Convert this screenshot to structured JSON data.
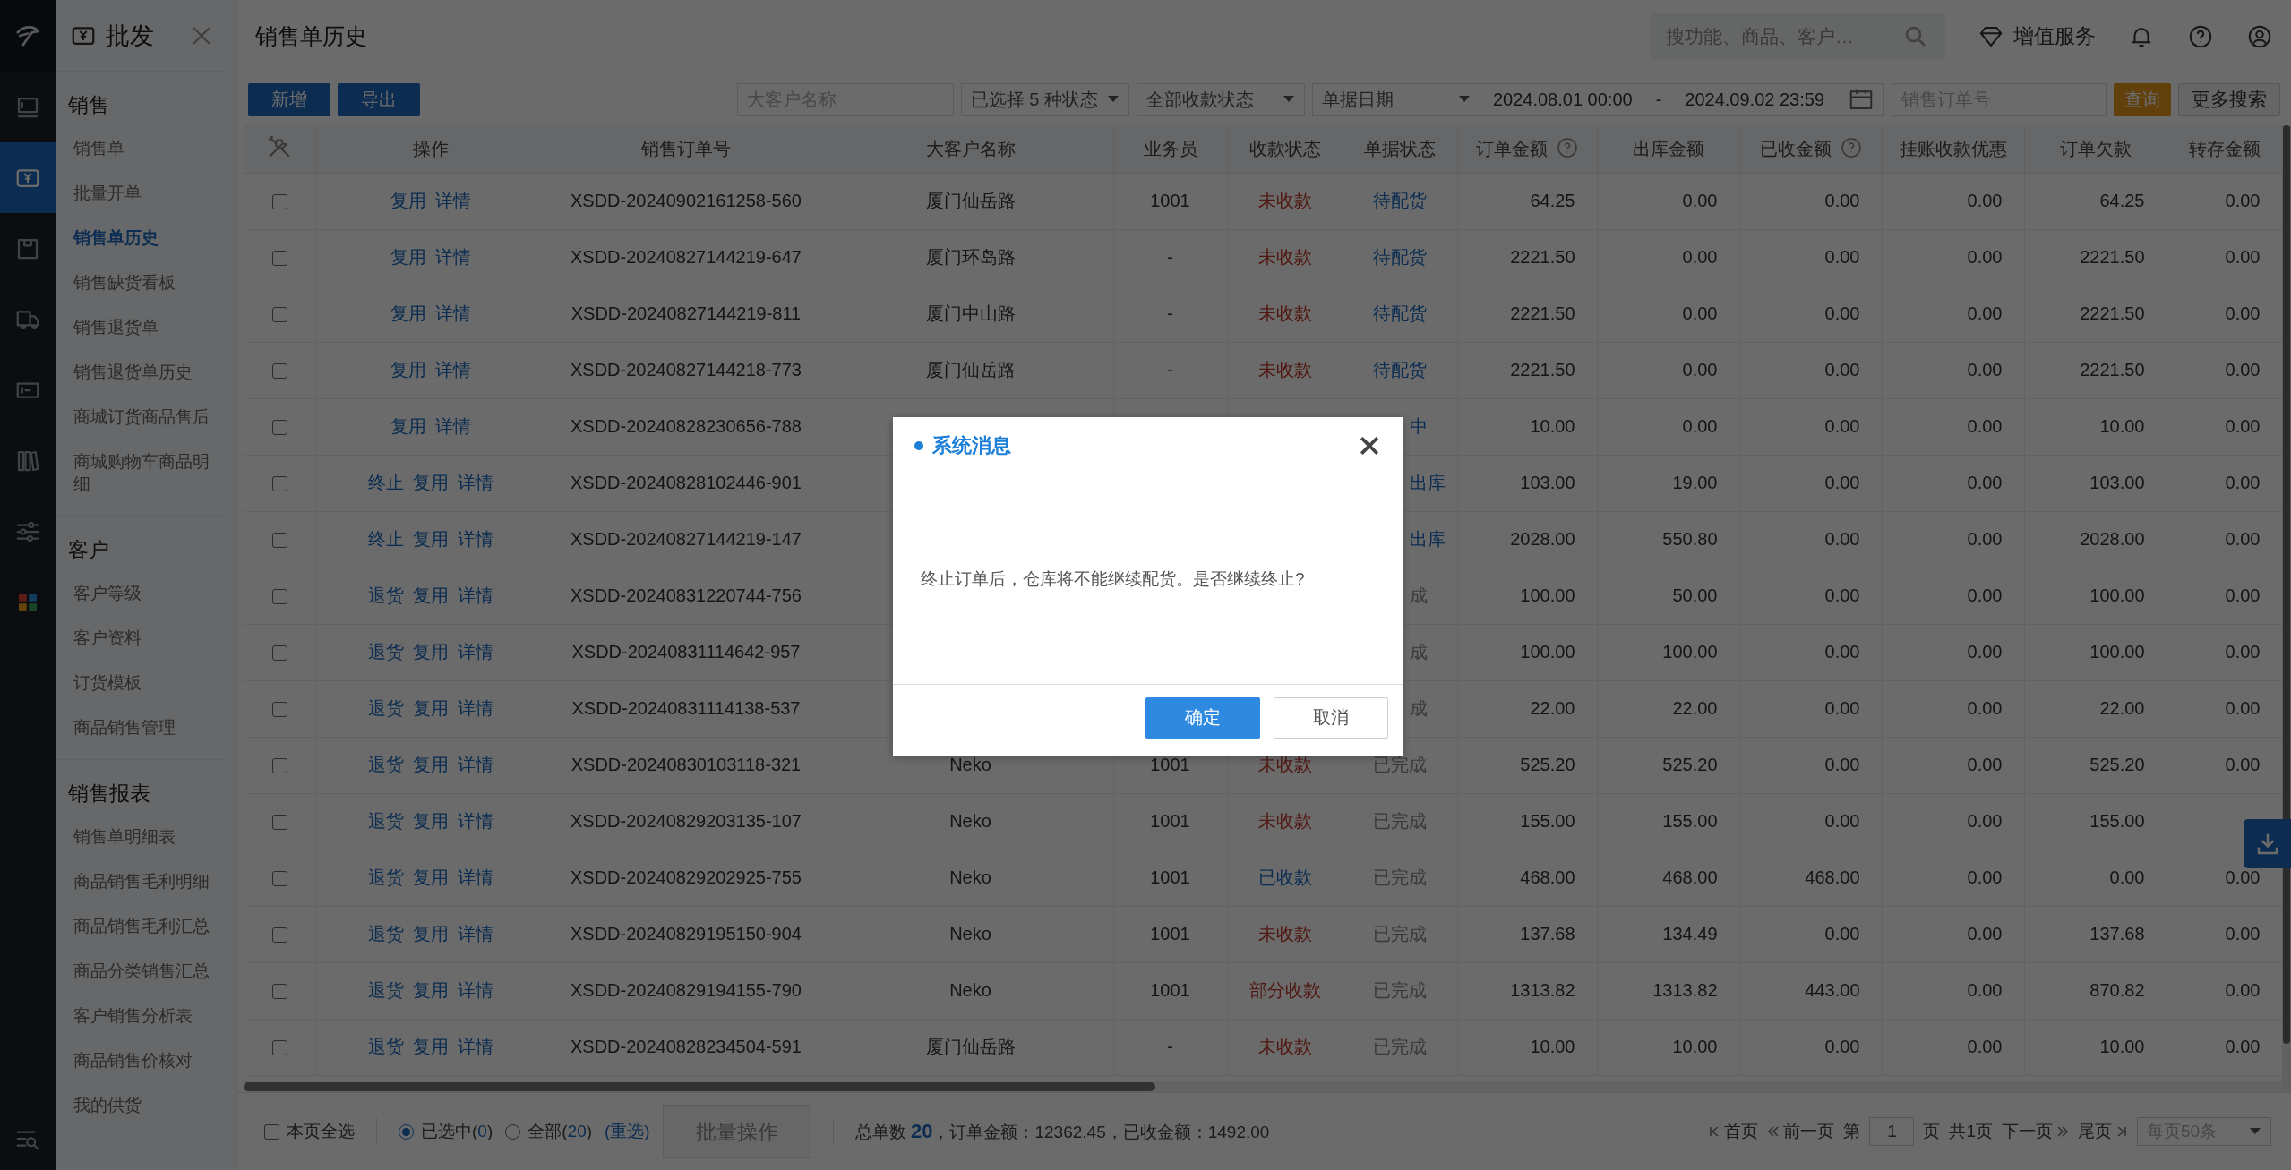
{
  "rail": {
    "items": [
      {
        "kind": "logo"
      },
      {
        "kind": "store",
        "selected": false
      },
      {
        "kind": "wholesale",
        "selected": true
      },
      {
        "kind": "box",
        "selected": false
      },
      {
        "kind": "truck",
        "selected": false
      },
      {
        "kind": "card",
        "selected": false
      },
      {
        "kind": "books",
        "selected": false
      },
      {
        "kind": "sliders",
        "selected": false
      },
      {
        "kind": "apps",
        "selected": false
      },
      {
        "kind": "search-list",
        "selected": false
      }
    ]
  },
  "sidebar": {
    "title": "批发",
    "sections": [
      {
        "title": "销售",
        "items": [
          {
            "label": "销售单",
            "selected": false
          },
          {
            "label": "批量开单",
            "selected": false
          },
          {
            "label": "销售单历史",
            "selected": true
          },
          {
            "label": "销售缺货看板",
            "selected": false
          },
          {
            "label": "销售退货单",
            "selected": false
          },
          {
            "label": "销售退货单历史",
            "selected": false
          },
          {
            "label": "商城订货商品售后",
            "selected": false
          },
          {
            "label": "商城购物车商品明细",
            "selected": false
          }
        ]
      },
      {
        "title": "客户",
        "items": [
          {
            "label": "客户等级",
            "selected": false
          },
          {
            "label": "客户资料",
            "selected": false
          },
          {
            "label": "订货模板",
            "selected": false
          },
          {
            "label": "商品销售管理",
            "selected": false
          }
        ]
      },
      {
        "title": "销售报表",
        "items": [
          {
            "label": "销售单明细表",
            "selected": false
          },
          {
            "label": "商品销售毛利明细",
            "selected": false
          },
          {
            "label": "商品销售毛利汇总",
            "selected": false
          },
          {
            "label": "商品分类销售汇总",
            "selected": false
          },
          {
            "label": "客户销售分析表",
            "selected": false
          },
          {
            "label": "商品销售价核对",
            "selected": false
          },
          {
            "label": "我的供货",
            "selected": false
          }
        ]
      }
    ]
  },
  "header": {
    "title": "销售单历史",
    "search": {
      "placeholder": "搜功能、商品、客户…"
    },
    "service": "增值服务"
  },
  "toolbar": {
    "buttons": [
      "新增",
      "导出"
    ],
    "filters": [
      {
        "kind": "input",
        "placeholder": "大客户名称"
      },
      {
        "kind": "select",
        "value": "已选择 5 种状态"
      },
      {
        "kind": "select",
        "value": "全部收款状态"
      },
      {
        "kind": "select",
        "value": "单据日期"
      },
      {
        "kind": "daterange",
        "start": "2024.08.01 00:00",
        "separator": "-",
        "end": "2024.09.02 23:59"
      },
      {
        "kind": "input",
        "placeholder": "销售订单号"
      }
    ],
    "query": "查询",
    "more": "更多搜索"
  },
  "table": {
    "columns": [
      {
        "label": "操作",
        "help": false
      },
      {
        "label": "销售订单号",
        "help": false
      },
      {
        "label": "大客户名称",
        "help": false
      },
      {
        "label": "业务员",
        "help": false
      },
      {
        "label": "收款状态",
        "help": false
      },
      {
        "label": "单据状态",
        "help": false
      },
      {
        "label": "订单金额",
        "help": true
      },
      {
        "label": "出库金额",
        "help": false
      },
      {
        "label": "已收金额",
        "help": true
      },
      {
        "label": "挂账收款优惠",
        "help": false
      },
      {
        "label": "订单欠款",
        "help": false
      },
      {
        "label": "转存金额",
        "help": false
      }
    ],
    "rows": [
      {
        "checked": false,
        "actions": [
          "复用",
          "详情"
        ],
        "order_no": "XSDD-20240902161258-560",
        "customer": "厦门仙岳路",
        "salesperson": "1001",
        "payment": {
          "text": "未收款",
          "kind": "unpaid"
        },
        "doc_status": {
          "text": "待配货",
          "kind": "pending",
          "covered": false
        },
        "amounts": [
          "64.25",
          "0.00",
          "0.00",
          "0.00",
          "64.25",
          "0.00"
        ]
      },
      {
        "checked": false,
        "actions": [
          "复用",
          "详情"
        ],
        "order_no": "XSDD-20240827144219-647",
        "customer": "厦门环岛路",
        "salesperson": "-",
        "payment": {
          "text": "未收款",
          "kind": "unpaid"
        },
        "doc_status": {
          "text": "待配货",
          "kind": "pending",
          "covered": false
        },
        "amounts": [
          "2221.50",
          "0.00",
          "0.00",
          "0.00",
          "2221.50",
          "0.00"
        ]
      },
      {
        "checked": false,
        "actions": [
          "复用",
          "详情"
        ],
        "order_no": "XSDD-20240827144219-811",
        "customer": "厦门中山路",
        "salesperson": "-",
        "payment": {
          "text": "未收款",
          "kind": "unpaid"
        },
        "doc_status": {
          "text": "待配货",
          "kind": "pending",
          "covered": false
        },
        "amounts": [
          "2221.50",
          "0.00",
          "0.00",
          "0.00",
          "2221.50",
          "0.00"
        ]
      },
      {
        "checked": false,
        "actions": [
          "复用",
          "详情"
        ],
        "order_no": "XSDD-20240827144218-773",
        "customer": "厦门仙岳路",
        "salesperson": "-",
        "payment": {
          "text": "未收款",
          "kind": "unpaid"
        },
        "doc_status": {
          "text": "待配货",
          "kind": "pending",
          "covered": false
        },
        "amounts": [
          "2221.50",
          "0.00",
          "0.00",
          "0.00",
          "2221.50",
          "0.00"
        ]
      },
      {
        "checked": false,
        "actions": [
          "复用",
          "详情"
        ],
        "order_no": "XSDD-20240828230656-788",
        "doc_status": {
          "text": "中",
          "kind": "pending",
          "covered": true
        },
        "amounts": [
          "10.00",
          "0.00",
          "0.00",
          "0.00",
          "10.00",
          "0.00"
        ]
      },
      {
        "checked": false,
        "actions": [
          "终止",
          "复用",
          "详情"
        ],
        "order_no": "XSDD-20240828102446-901",
        "doc_status": {
          "text": "出库",
          "kind": "pending",
          "covered": true
        },
        "amounts": [
          "103.00",
          "19.00",
          "0.00",
          "0.00",
          "103.00",
          "0.00"
        ]
      },
      {
        "checked": false,
        "actions": [
          "终止",
          "复用",
          "详情"
        ],
        "order_no": "XSDD-20240827144219-147",
        "doc_status": {
          "text": "出库",
          "kind": "pending",
          "covered": true
        },
        "amounts": [
          "2028.00",
          "550.80",
          "0.00",
          "0.00",
          "2028.00",
          "0.00"
        ]
      },
      {
        "checked": false,
        "actions": [
          "退货",
          "复用",
          "详情"
        ],
        "order_no": "XSDD-20240831220744-756",
        "doc_status": {
          "text": "成",
          "kind": "done",
          "covered": true
        },
        "amounts": [
          "100.00",
          "50.00",
          "0.00",
          "0.00",
          "100.00",
          "0.00"
        ]
      },
      {
        "checked": false,
        "actions": [
          "退货",
          "复用",
          "详情"
        ],
        "order_no": "XSDD-20240831114642-957",
        "doc_status": {
          "text": "成",
          "kind": "done",
          "covered": true
        },
        "amounts": [
          "100.00",
          "100.00",
          "0.00",
          "0.00",
          "100.00",
          "0.00"
        ]
      },
      {
        "checked": false,
        "actions": [
          "退货",
          "复用",
          "详情"
        ],
        "order_no": "XSDD-20240831114138-537",
        "doc_status": {
          "text": "成",
          "kind": "done",
          "covered": true
        },
        "amounts": [
          "22.00",
          "22.00",
          "0.00",
          "0.00",
          "22.00",
          "0.00"
        ]
      },
      {
        "checked": false,
        "actions": [
          "退货",
          "复用",
          "详情"
        ],
        "order_no": "XSDD-20240830103118-321",
        "customer": "Neko",
        "salesperson": "1001",
        "payment": {
          "text": "未收款",
          "kind": "unpaid"
        },
        "doc_status": {
          "text": "已完成",
          "kind": "done",
          "covered": false
        },
        "amounts": [
          "525.20",
          "525.20",
          "0.00",
          "0.00",
          "525.20",
          "0.00"
        ]
      },
      {
        "checked": false,
        "actions": [
          "退货",
          "复用",
          "详情"
        ],
        "order_no": "XSDD-20240829203135-107",
        "customer": "Neko",
        "salesperson": "1001",
        "payment": {
          "text": "未收款",
          "kind": "unpaid"
        },
        "doc_status": {
          "text": "已完成",
          "kind": "done",
          "covered": false
        },
        "amounts": [
          "155.00",
          "155.00",
          "0.00",
          "0.00",
          "155.00"
        ]
      },
      {
        "checked": false,
        "actions": [
          "退货",
          "复用",
          "详情"
        ],
        "order_no": "XSDD-20240829202925-755",
        "customer": "Neko",
        "salesperson": "1001",
        "payment": {
          "text": "已收款",
          "kind": "paid"
        },
        "doc_status": {
          "text": "已完成",
          "kind": "done",
          "covered": false
        },
        "amounts": [
          "468.00",
          "468.00",
          "468.00",
          "0.00",
          "0.00",
          "0.00"
        ]
      },
      {
        "checked": false,
        "actions": [
          "退货",
          "复用",
          "详情"
        ],
        "order_no": "XSDD-20240829195150-904",
        "customer": "Neko",
        "salesperson": "1001",
        "payment": {
          "text": "未收款",
          "kind": "unpaid"
        },
        "doc_status": {
          "text": "已完成",
          "kind": "done",
          "covered": false
        },
        "amounts": [
          "137.68",
          "134.49",
          "0.00",
          "0.00",
          "137.68",
          "0.00"
        ]
      },
      {
        "checked": false,
        "actions": [
          "退货",
          "复用",
          "详情"
        ],
        "order_no": "XSDD-20240829194155-790",
        "customer": "Neko",
        "salesperson": "1001",
        "payment": {
          "text": "部分收款",
          "kind": "partial"
        },
        "doc_status": {
          "text": "已完成",
          "kind": "done",
          "covered": false
        },
        "amounts": [
          "1313.82",
          "1313.82",
          "443.00",
          "0.00",
          "870.82",
          "0.00"
        ]
      },
      {
        "checked": false,
        "actions": [
          "退货",
          "复用",
          "详情"
        ],
        "order_no": "XSDD-20240828234504-591",
        "customer": "厦门仙岳路",
        "salesperson": "-",
        "payment": {
          "text": "未收款",
          "kind": "unpaid"
        },
        "doc_status": {
          "text": "已完成",
          "kind": "done",
          "covered": false
        },
        "amounts": [
          "10.00",
          "10.00",
          "0.00",
          "0.00",
          "10.00",
          "0.00"
        ]
      }
    ]
  },
  "footer": {
    "select_page": {
      "label": "本页全选",
      "checked": false
    },
    "radios": [
      {
        "label": "已选中(**0**)",
        "selected": true
      },
      {
        "label": "全部(**20**)",
        "selected": false
      }
    ],
    "reselect": "(重选)",
    "batch": {
      "label": "批量操作",
      "disabled": true
    },
    "summary": "总单数 **20**，订单金额：12362.45，已收金额：1492.00",
    "pager": {
      "first": "首页",
      "prev": "前一页",
      "page_prefix": "第",
      "page": "1",
      "page_suffix": "页",
      "total": "共1页",
      "next": "下一页",
      "last": "尾页",
      "per_page": "每页50条"
    }
  },
  "dialog": {
    "title": "系统消息",
    "message": "终止订单后，仓库将不能继续配货。是否继续终止?",
    "buttons": [
      {
        "label": "确定",
        "kind": "primary"
      },
      {
        "label": "取消",
        "kind": "default"
      }
    ]
  }
}
